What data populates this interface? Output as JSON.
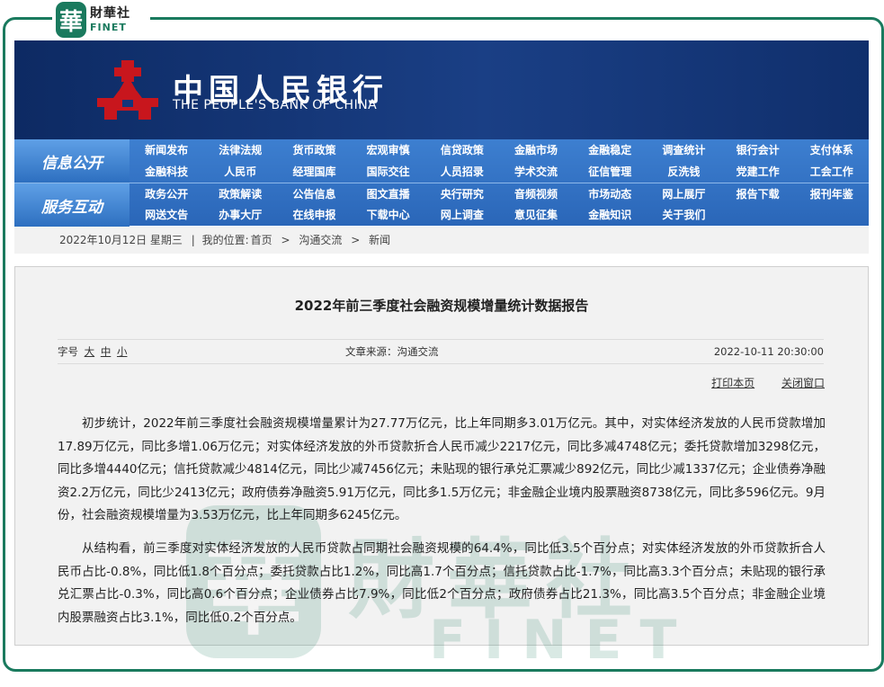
{
  "finet_logo": {
    "mark": "華",
    "cn": "財華社",
    "en": "FINET"
  },
  "banner": {
    "cn": "中国人民银行",
    "en": "THE PEOPLE'S BANK OF CHINA"
  },
  "nav": {
    "group1": "信息公开",
    "group2": "服务互动",
    "row1": [
      "新闻发布",
      "法律法规",
      "货币政策",
      "宏观审慎",
      "信贷政策",
      "金融市场",
      "金融稳定",
      "调查统计",
      "银行会计",
      "支付体系"
    ],
    "row2": [
      "金融科技",
      "人民币",
      "经理国库",
      "国际交往",
      "人员招录",
      "学术交流",
      "征信管理",
      "反洗钱",
      "党建工作",
      "工会工作"
    ],
    "row3": [
      "政务公开",
      "政策解读",
      "公告信息",
      "图文直播",
      "央行研究",
      "音频视频",
      "市场动态",
      "网上展厅",
      "报告下载",
      "报刊年鉴"
    ],
    "row4": [
      "网送文告",
      "办事大厅",
      "在线申报",
      "下载中心",
      "网上调查",
      "意见征集",
      "金融知识",
      "关于我们"
    ]
  },
  "breadcrumb": {
    "date": "2022年10月12日 星期三",
    "sep": "|",
    "location_label": "我的位置:",
    "home": "首页",
    "arrow": ">",
    "level1": "沟通交流",
    "level2": "新闻"
  },
  "article": {
    "title": "2022年前三季度社会融资规模增量统计数据报告",
    "font_label": "字号",
    "font_large": "大",
    "font_medium": "中",
    "font_small": "小",
    "source": "文章来源：沟通交流",
    "time": "2022-10-11 20:30:00",
    "print": "打印本页",
    "close": "关闭窗口",
    "para1": "初步统计，2022年前三季度社会融资规模增量累计为27.77万亿元，比上年同期多3.01万亿元。其中，对实体经济发放的人民币贷款增加17.89万亿元，同比多增1.06万亿元；对实体经济发放的外币贷款折合人民币减少2217亿元，同比多减4748亿元；委托贷款增加3298亿元，同比多增4440亿元；信托贷款减少4814亿元，同比少减7456亿元；未贴现的银行承兑汇票减少892亿元，同比少减1337亿元；企业债券净融资2.2万亿元，同比少2413亿元；政府债券净融资5.91万亿元，同比多1.5万亿元；非金融企业境内股票融资8738亿元，同比多596亿元。9月份，社会融资规模增量为3.53万亿元，比上年同期多6245亿元。",
    "para2": "从结构看，前三季度对实体经济发放的人民币贷款占同期社会融资规模的64.4%，同比低3.5个百分点；对实体经济发放的外币贷款折合人民币占比-0.8%，同比低1.8个百分点；委托贷款占比1.2%，同比高1.7个百分点；信托贷款占比-1.7%，同比高3.3个百分点；未贴现的银行承兑汇票占比-0.3%，同比高0.6个百分点；企业债券占比7.9%，同比低2个百分点；政府债券占比21.3%，同比高3.5个百分点；非金融企业境内股票融资占比3.1%，同比低0.2个百分点。"
  },
  "watermark": {
    "mark": "華",
    "cn": "財華社",
    "en": "FINET"
  },
  "colors": {
    "finet_green": "#1a7a5e",
    "banner_blue": "#0d2a63",
    "nav_blue": "#2a66b8",
    "emblem_red": "#c8161d"
  }
}
